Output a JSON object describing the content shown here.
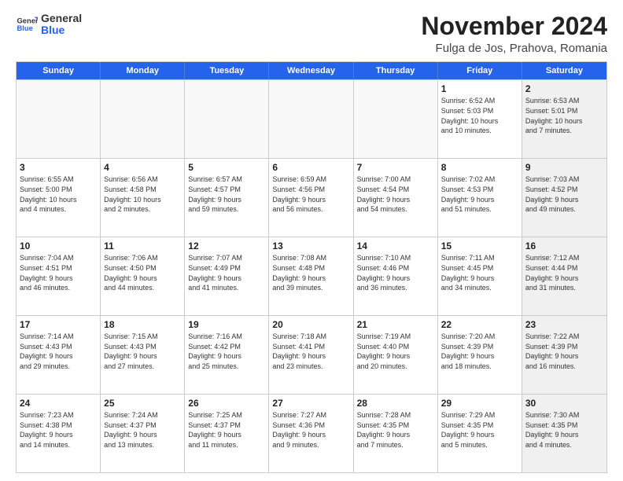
{
  "header": {
    "logo_line1": "General",
    "logo_line2": "Blue",
    "month_title": "November 2024",
    "location": "Fulga de Jos, Prahova, Romania"
  },
  "weekdays": [
    "Sunday",
    "Monday",
    "Tuesday",
    "Wednesday",
    "Thursday",
    "Friday",
    "Saturday"
  ],
  "weeks": [
    [
      {
        "day": "",
        "info": "",
        "shaded": false,
        "empty": true
      },
      {
        "day": "",
        "info": "",
        "shaded": false,
        "empty": true
      },
      {
        "day": "",
        "info": "",
        "shaded": false,
        "empty": true
      },
      {
        "day": "",
        "info": "",
        "shaded": false,
        "empty": true
      },
      {
        "day": "",
        "info": "",
        "shaded": false,
        "empty": true
      },
      {
        "day": "1",
        "info": "Sunrise: 6:52 AM\nSunset: 5:03 PM\nDaylight: 10 hours\nand 10 minutes.",
        "shaded": false,
        "empty": false
      },
      {
        "day": "2",
        "info": "Sunrise: 6:53 AM\nSunset: 5:01 PM\nDaylight: 10 hours\nand 7 minutes.",
        "shaded": true,
        "empty": false
      }
    ],
    [
      {
        "day": "3",
        "info": "Sunrise: 6:55 AM\nSunset: 5:00 PM\nDaylight: 10 hours\nand 4 minutes.",
        "shaded": false,
        "empty": false
      },
      {
        "day": "4",
        "info": "Sunrise: 6:56 AM\nSunset: 4:58 PM\nDaylight: 10 hours\nand 2 minutes.",
        "shaded": false,
        "empty": false
      },
      {
        "day": "5",
        "info": "Sunrise: 6:57 AM\nSunset: 4:57 PM\nDaylight: 9 hours\nand 59 minutes.",
        "shaded": false,
        "empty": false
      },
      {
        "day": "6",
        "info": "Sunrise: 6:59 AM\nSunset: 4:56 PM\nDaylight: 9 hours\nand 56 minutes.",
        "shaded": false,
        "empty": false
      },
      {
        "day": "7",
        "info": "Sunrise: 7:00 AM\nSunset: 4:54 PM\nDaylight: 9 hours\nand 54 minutes.",
        "shaded": false,
        "empty": false
      },
      {
        "day": "8",
        "info": "Sunrise: 7:02 AM\nSunset: 4:53 PM\nDaylight: 9 hours\nand 51 minutes.",
        "shaded": false,
        "empty": false
      },
      {
        "day": "9",
        "info": "Sunrise: 7:03 AM\nSunset: 4:52 PM\nDaylight: 9 hours\nand 49 minutes.",
        "shaded": true,
        "empty": false
      }
    ],
    [
      {
        "day": "10",
        "info": "Sunrise: 7:04 AM\nSunset: 4:51 PM\nDaylight: 9 hours\nand 46 minutes.",
        "shaded": false,
        "empty": false
      },
      {
        "day": "11",
        "info": "Sunrise: 7:06 AM\nSunset: 4:50 PM\nDaylight: 9 hours\nand 44 minutes.",
        "shaded": false,
        "empty": false
      },
      {
        "day": "12",
        "info": "Sunrise: 7:07 AM\nSunset: 4:49 PM\nDaylight: 9 hours\nand 41 minutes.",
        "shaded": false,
        "empty": false
      },
      {
        "day": "13",
        "info": "Sunrise: 7:08 AM\nSunset: 4:48 PM\nDaylight: 9 hours\nand 39 minutes.",
        "shaded": false,
        "empty": false
      },
      {
        "day": "14",
        "info": "Sunrise: 7:10 AM\nSunset: 4:46 PM\nDaylight: 9 hours\nand 36 minutes.",
        "shaded": false,
        "empty": false
      },
      {
        "day": "15",
        "info": "Sunrise: 7:11 AM\nSunset: 4:45 PM\nDaylight: 9 hours\nand 34 minutes.",
        "shaded": false,
        "empty": false
      },
      {
        "day": "16",
        "info": "Sunrise: 7:12 AM\nSunset: 4:44 PM\nDaylight: 9 hours\nand 31 minutes.",
        "shaded": true,
        "empty": false
      }
    ],
    [
      {
        "day": "17",
        "info": "Sunrise: 7:14 AM\nSunset: 4:43 PM\nDaylight: 9 hours\nand 29 minutes.",
        "shaded": false,
        "empty": false
      },
      {
        "day": "18",
        "info": "Sunrise: 7:15 AM\nSunset: 4:43 PM\nDaylight: 9 hours\nand 27 minutes.",
        "shaded": false,
        "empty": false
      },
      {
        "day": "19",
        "info": "Sunrise: 7:16 AM\nSunset: 4:42 PM\nDaylight: 9 hours\nand 25 minutes.",
        "shaded": false,
        "empty": false
      },
      {
        "day": "20",
        "info": "Sunrise: 7:18 AM\nSunset: 4:41 PM\nDaylight: 9 hours\nand 23 minutes.",
        "shaded": false,
        "empty": false
      },
      {
        "day": "21",
        "info": "Sunrise: 7:19 AM\nSunset: 4:40 PM\nDaylight: 9 hours\nand 20 minutes.",
        "shaded": false,
        "empty": false
      },
      {
        "day": "22",
        "info": "Sunrise: 7:20 AM\nSunset: 4:39 PM\nDaylight: 9 hours\nand 18 minutes.",
        "shaded": false,
        "empty": false
      },
      {
        "day": "23",
        "info": "Sunrise: 7:22 AM\nSunset: 4:39 PM\nDaylight: 9 hours\nand 16 minutes.",
        "shaded": true,
        "empty": false
      }
    ],
    [
      {
        "day": "24",
        "info": "Sunrise: 7:23 AM\nSunset: 4:38 PM\nDaylight: 9 hours\nand 14 minutes.",
        "shaded": false,
        "empty": false
      },
      {
        "day": "25",
        "info": "Sunrise: 7:24 AM\nSunset: 4:37 PM\nDaylight: 9 hours\nand 13 minutes.",
        "shaded": false,
        "empty": false
      },
      {
        "day": "26",
        "info": "Sunrise: 7:25 AM\nSunset: 4:37 PM\nDaylight: 9 hours\nand 11 minutes.",
        "shaded": false,
        "empty": false
      },
      {
        "day": "27",
        "info": "Sunrise: 7:27 AM\nSunset: 4:36 PM\nDaylight: 9 hours\nand 9 minutes.",
        "shaded": false,
        "empty": false
      },
      {
        "day": "28",
        "info": "Sunrise: 7:28 AM\nSunset: 4:35 PM\nDaylight: 9 hours\nand 7 minutes.",
        "shaded": false,
        "empty": false
      },
      {
        "day": "29",
        "info": "Sunrise: 7:29 AM\nSunset: 4:35 PM\nDaylight: 9 hours\nand 5 minutes.",
        "shaded": false,
        "empty": false
      },
      {
        "day": "30",
        "info": "Sunrise: 7:30 AM\nSunset: 4:35 PM\nDaylight: 9 hours\nand 4 minutes.",
        "shaded": true,
        "empty": false
      }
    ]
  ]
}
